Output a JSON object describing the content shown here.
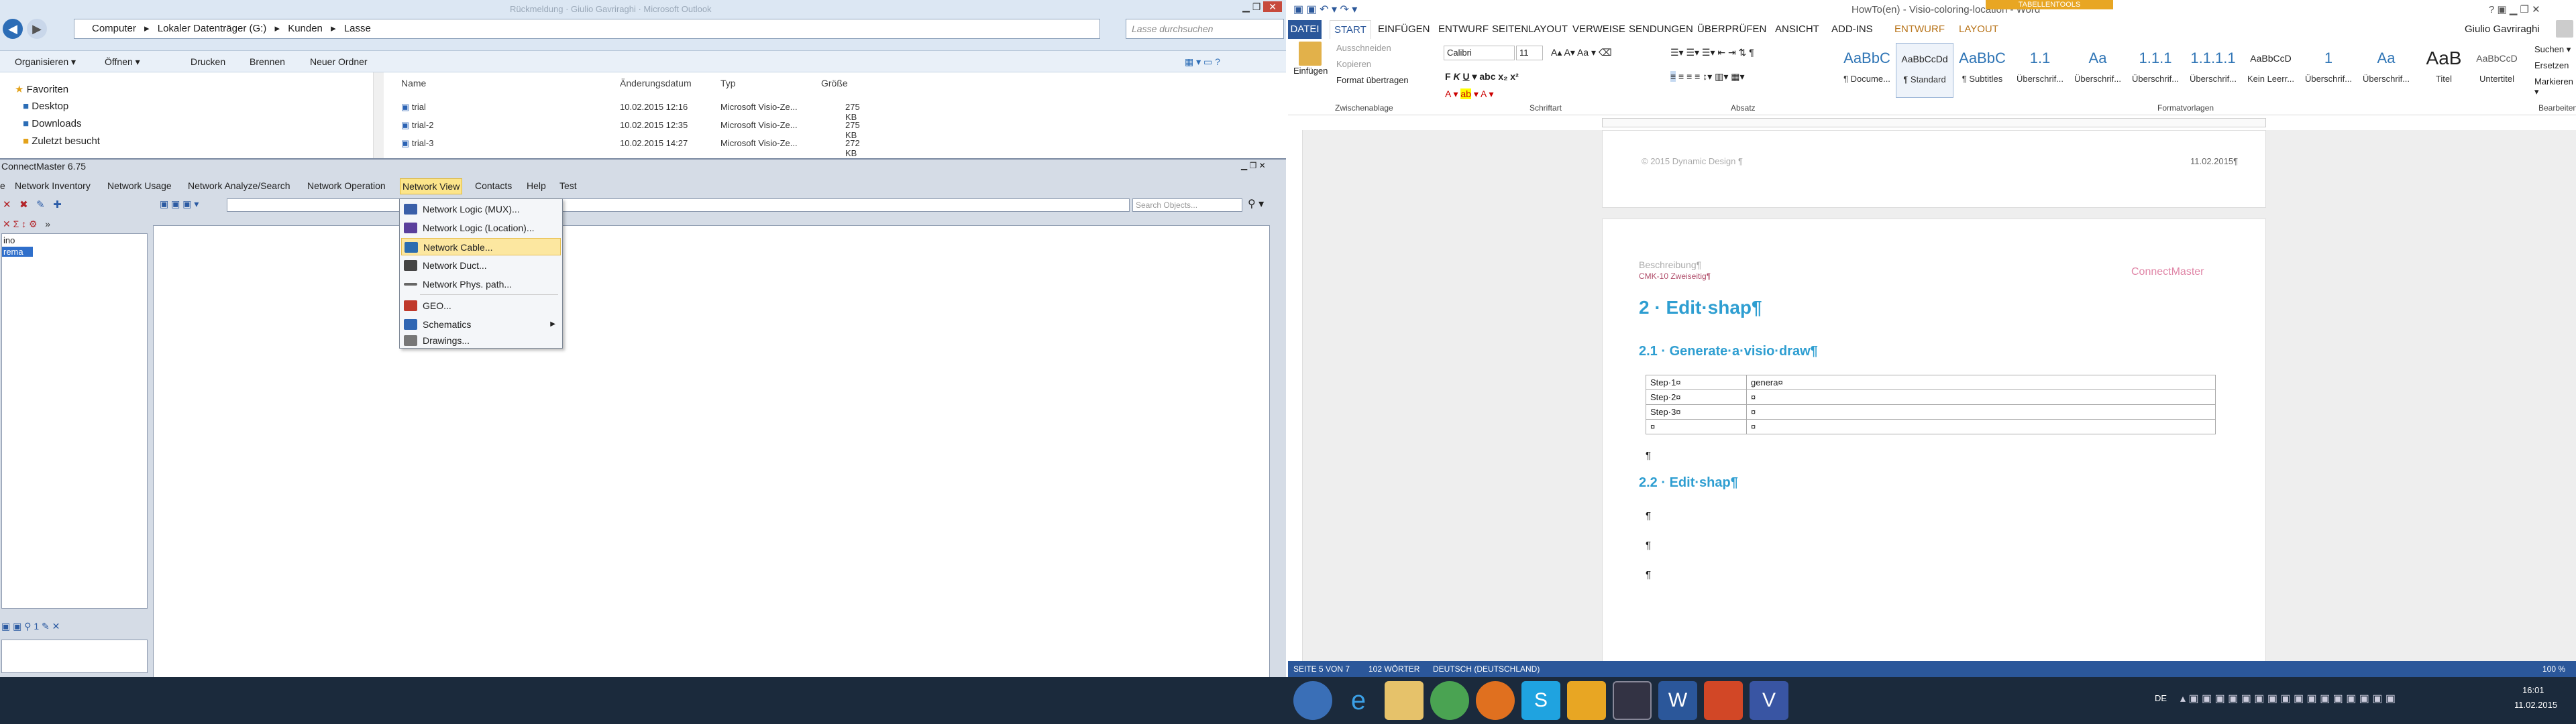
{
  "explorer": {
    "nav_back": "◀",
    "nav_forward": "▶",
    "address_parts": [
      "Computer",
      "▸",
      "Lokaler Datenträger (G:)",
      "▸",
      "Kunden",
      "▸",
      "Lasse"
    ],
    "title_hint": "Rückmeldung · Giulio Gavriraghi · Microsoft Outlook",
    "search_placeholder": "Lasse durchsuchen",
    "toolbar": {
      "organize": "Organisieren ▾",
      "open": "Öffnen ▾",
      "print": "Drucken",
      "burn": "Brennen",
      "new_folder": "Neuer Ordner"
    },
    "favorites_title": "Favoriten",
    "favorites": [
      "Desktop",
      "Downloads",
      "Zuletzt besucht"
    ],
    "columns": {
      "name": "Name",
      "date": "Änderungsdatum",
      "type": "Typ",
      "size": "Größe"
    },
    "files": [
      {
        "name": "trial",
        "date": "10.02.2015 12:16",
        "type": "Microsoft Visio-Ze...",
        "size": "275 KB"
      },
      {
        "name": "trial-2",
        "date": "10.02.2015 12:35",
        "type": "Microsoft Visio-Ze...",
        "size": "275 KB"
      },
      {
        "name": "trial-3",
        "date": "10.02.2015 14:27",
        "type": "Microsoft Visio-Ze...",
        "size": "272 KB"
      }
    ]
  },
  "connectmaster": {
    "title": "ConnectMaster 6.75",
    "menu": [
      "e",
      "Network Inventory",
      "Network Usage",
      "Network Analyze/Search",
      "Network Operation",
      "Network View",
      "Contacts",
      "Help",
      "Test"
    ],
    "active_menu": "Network View",
    "search_placeholder": "Search Objects...",
    "tree_items": [
      "ino",
      "rema"
    ],
    "dropdown": [
      {
        "label": "Network Logic (MUX)...",
        "color": "#3a5fa8"
      },
      {
        "label": "Network Logic (Location)...",
        "color": "#5a3f9c"
      },
      {
        "label": "Network Cable...",
        "color": "#2b6cb0",
        "highlighted": true
      },
      {
        "label": "Network Duct...",
        "color": "#444444"
      },
      {
        "label": "Network Phys. path...",
        "color": "#555555"
      },
      {
        "label": "GEO...",
        "color": "#c0392b"
      },
      {
        "label": "Schematics",
        "color": "#3066b3",
        "submenu": true
      },
      {
        "label": "Drawings...",
        "color": "#777777"
      }
    ]
  },
  "word": {
    "title": "HowTo(en) - Visio-coloring-location - Word",
    "table_tools": "TABELLENTOOLS",
    "tabs": [
      "DATEI",
      "START",
      "EINFÜGEN",
      "ENTWURF",
      "SEITENLAYOUT",
      "VERWEISE",
      "SENDUNGEN",
      "ÜBERPRÜFEN",
      "ANSICHT",
      "ADD-INS",
      "ENTWURF",
      "LAYOUT"
    ],
    "active_tab": "START",
    "user": "Giulio Gavriraghi",
    "clipboard": {
      "paste": "Einfügen",
      "cut": "Ausschneiden",
      "copy": "Kopieren",
      "format": "Format übertragen",
      "label": "Zwischenablage"
    },
    "font": {
      "name": "Calibri",
      "size": "11",
      "label": "Schriftart"
    },
    "paragraph_label": "Absatz",
    "styles_label": "Formatvorlagen",
    "styles": [
      {
        "preview": "AaBbC",
        "name": "¶ Docume..."
      },
      {
        "preview": "AaBbCcDd",
        "name": "¶ Standard"
      },
      {
        "preview": "AaBbC",
        "name": "¶ Subtitles"
      },
      {
        "preview": "1.1",
        "name": "Überschrif..."
      },
      {
        "preview": "Aa",
        "name": "Überschrif..."
      },
      {
        "preview": "1.1.1",
        "name": "Überschrif..."
      },
      {
        "preview": "1.1.1.1",
        "name": "Überschrif..."
      },
      {
        "preview": "AaBbCcD",
        "name": "Kein Leerr..."
      },
      {
        "preview": "1",
        "name": "Überschrif..."
      },
      {
        "preview": "Aa",
        "name": "Überschrif..."
      },
      {
        "preview": "AaB",
        "name": "Titel"
      },
      {
        "preview": "AaBbCcD",
        "name": "Untertitel"
      }
    ],
    "editing": {
      "find": "Suchen ▾",
      "replace": "Ersetzen",
      "select": "Markieren ▾",
      "label": "Bearbeiten"
    },
    "footer_left": "© 2015 Dynamic Design ¶",
    "footer_date": "11.02.2015¶",
    "doc_meta": "Beschreibung¶",
    "doc_meta2": "CMK-10 Zweiseitig¶",
    "logo": "ConnectMaster",
    "h2": "2 · Edit·shap¶",
    "h21": "2.1 · Generate·a·visio·draw¶",
    "table": [
      [
        "Step·1¤",
        "genera¤"
      ],
      [
        "Step·2¤",
        "¤"
      ],
      [
        "Step·3¤",
        "¤"
      ],
      [
        "¤",
        "¤"
      ]
    ],
    "h22": "2.2 · Edit·shap¶",
    "pilcrow": "¶",
    "status": {
      "page": "SEITE 5 VON 7",
      "words": "102 WÖRTER",
      "lang": "DEUTSCH (DEUTSCHLAND)",
      "zoom": "100 %"
    }
  },
  "taskbar": {
    "time": "16:01",
    "date": "11.02.2015",
    "lang": "DE",
    "apps": [
      "start-orb",
      "internet-explorer",
      "file-explorer",
      "chrome",
      "firefox",
      "skype",
      "outlook",
      "connectmaster",
      "word",
      "powerpoint",
      "visio"
    ]
  }
}
